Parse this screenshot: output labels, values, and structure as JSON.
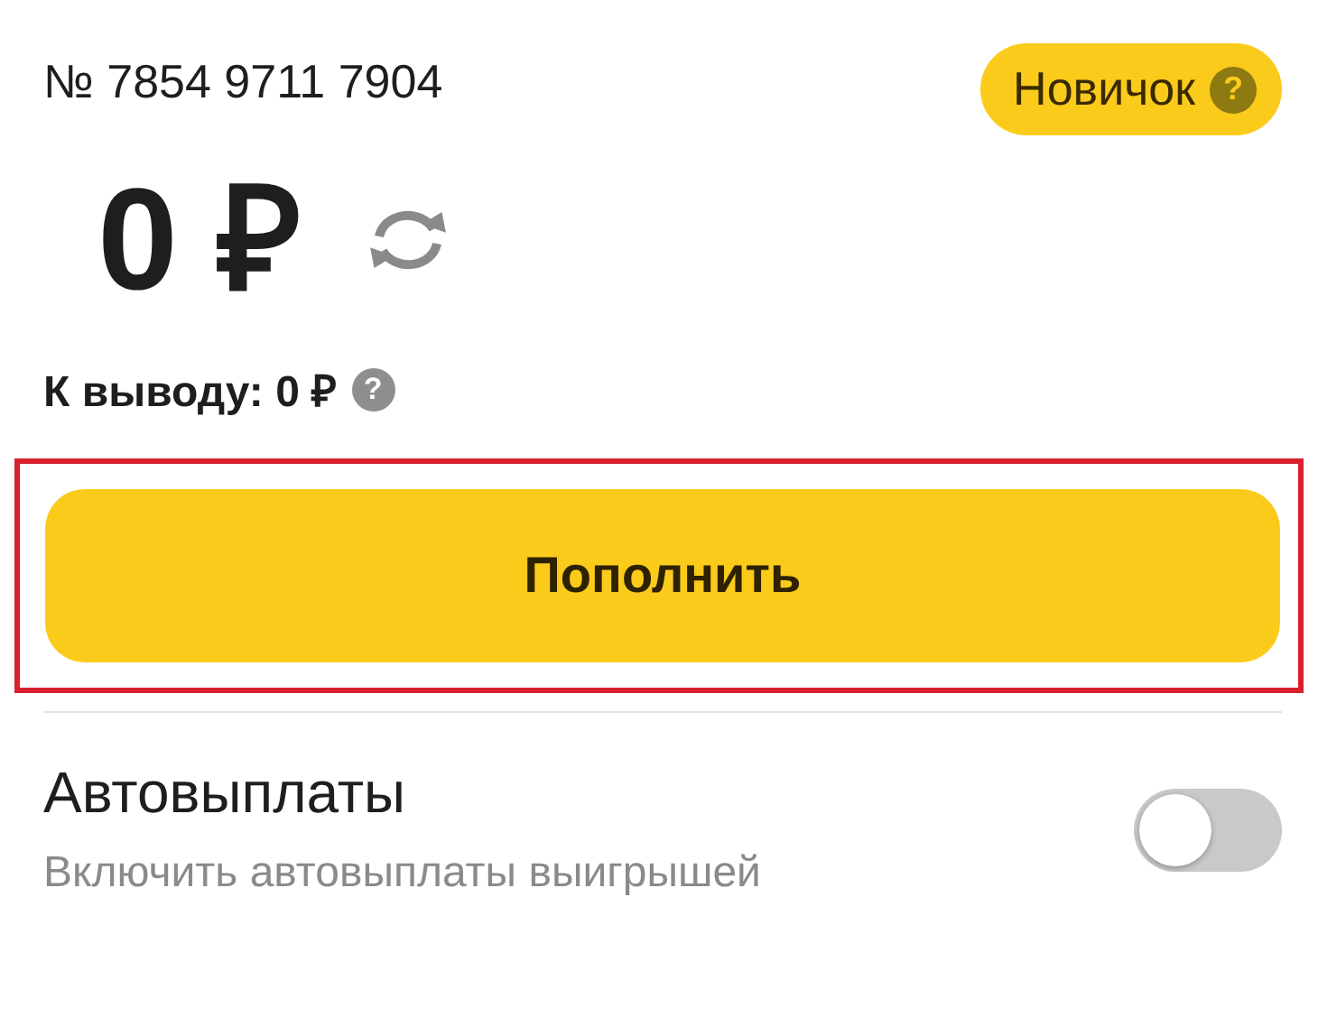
{
  "account_number": "№ 7854 9711 7904",
  "status_badge": {
    "label": "Новичок",
    "help_icon": "?"
  },
  "balance": {
    "amount": "0 ₽"
  },
  "withdrawable": {
    "label": "К выводу: 0 ₽",
    "help_icon": "?"
  },
  "top_up_button": {
    "label": "Пополнить",
    "highlighted": true
  },
  "autopayouts": {
    "title": "Автовыплаты",
    "subtitle": "Включить автовыплаты выигрышей",
    "on": false
  }
}
